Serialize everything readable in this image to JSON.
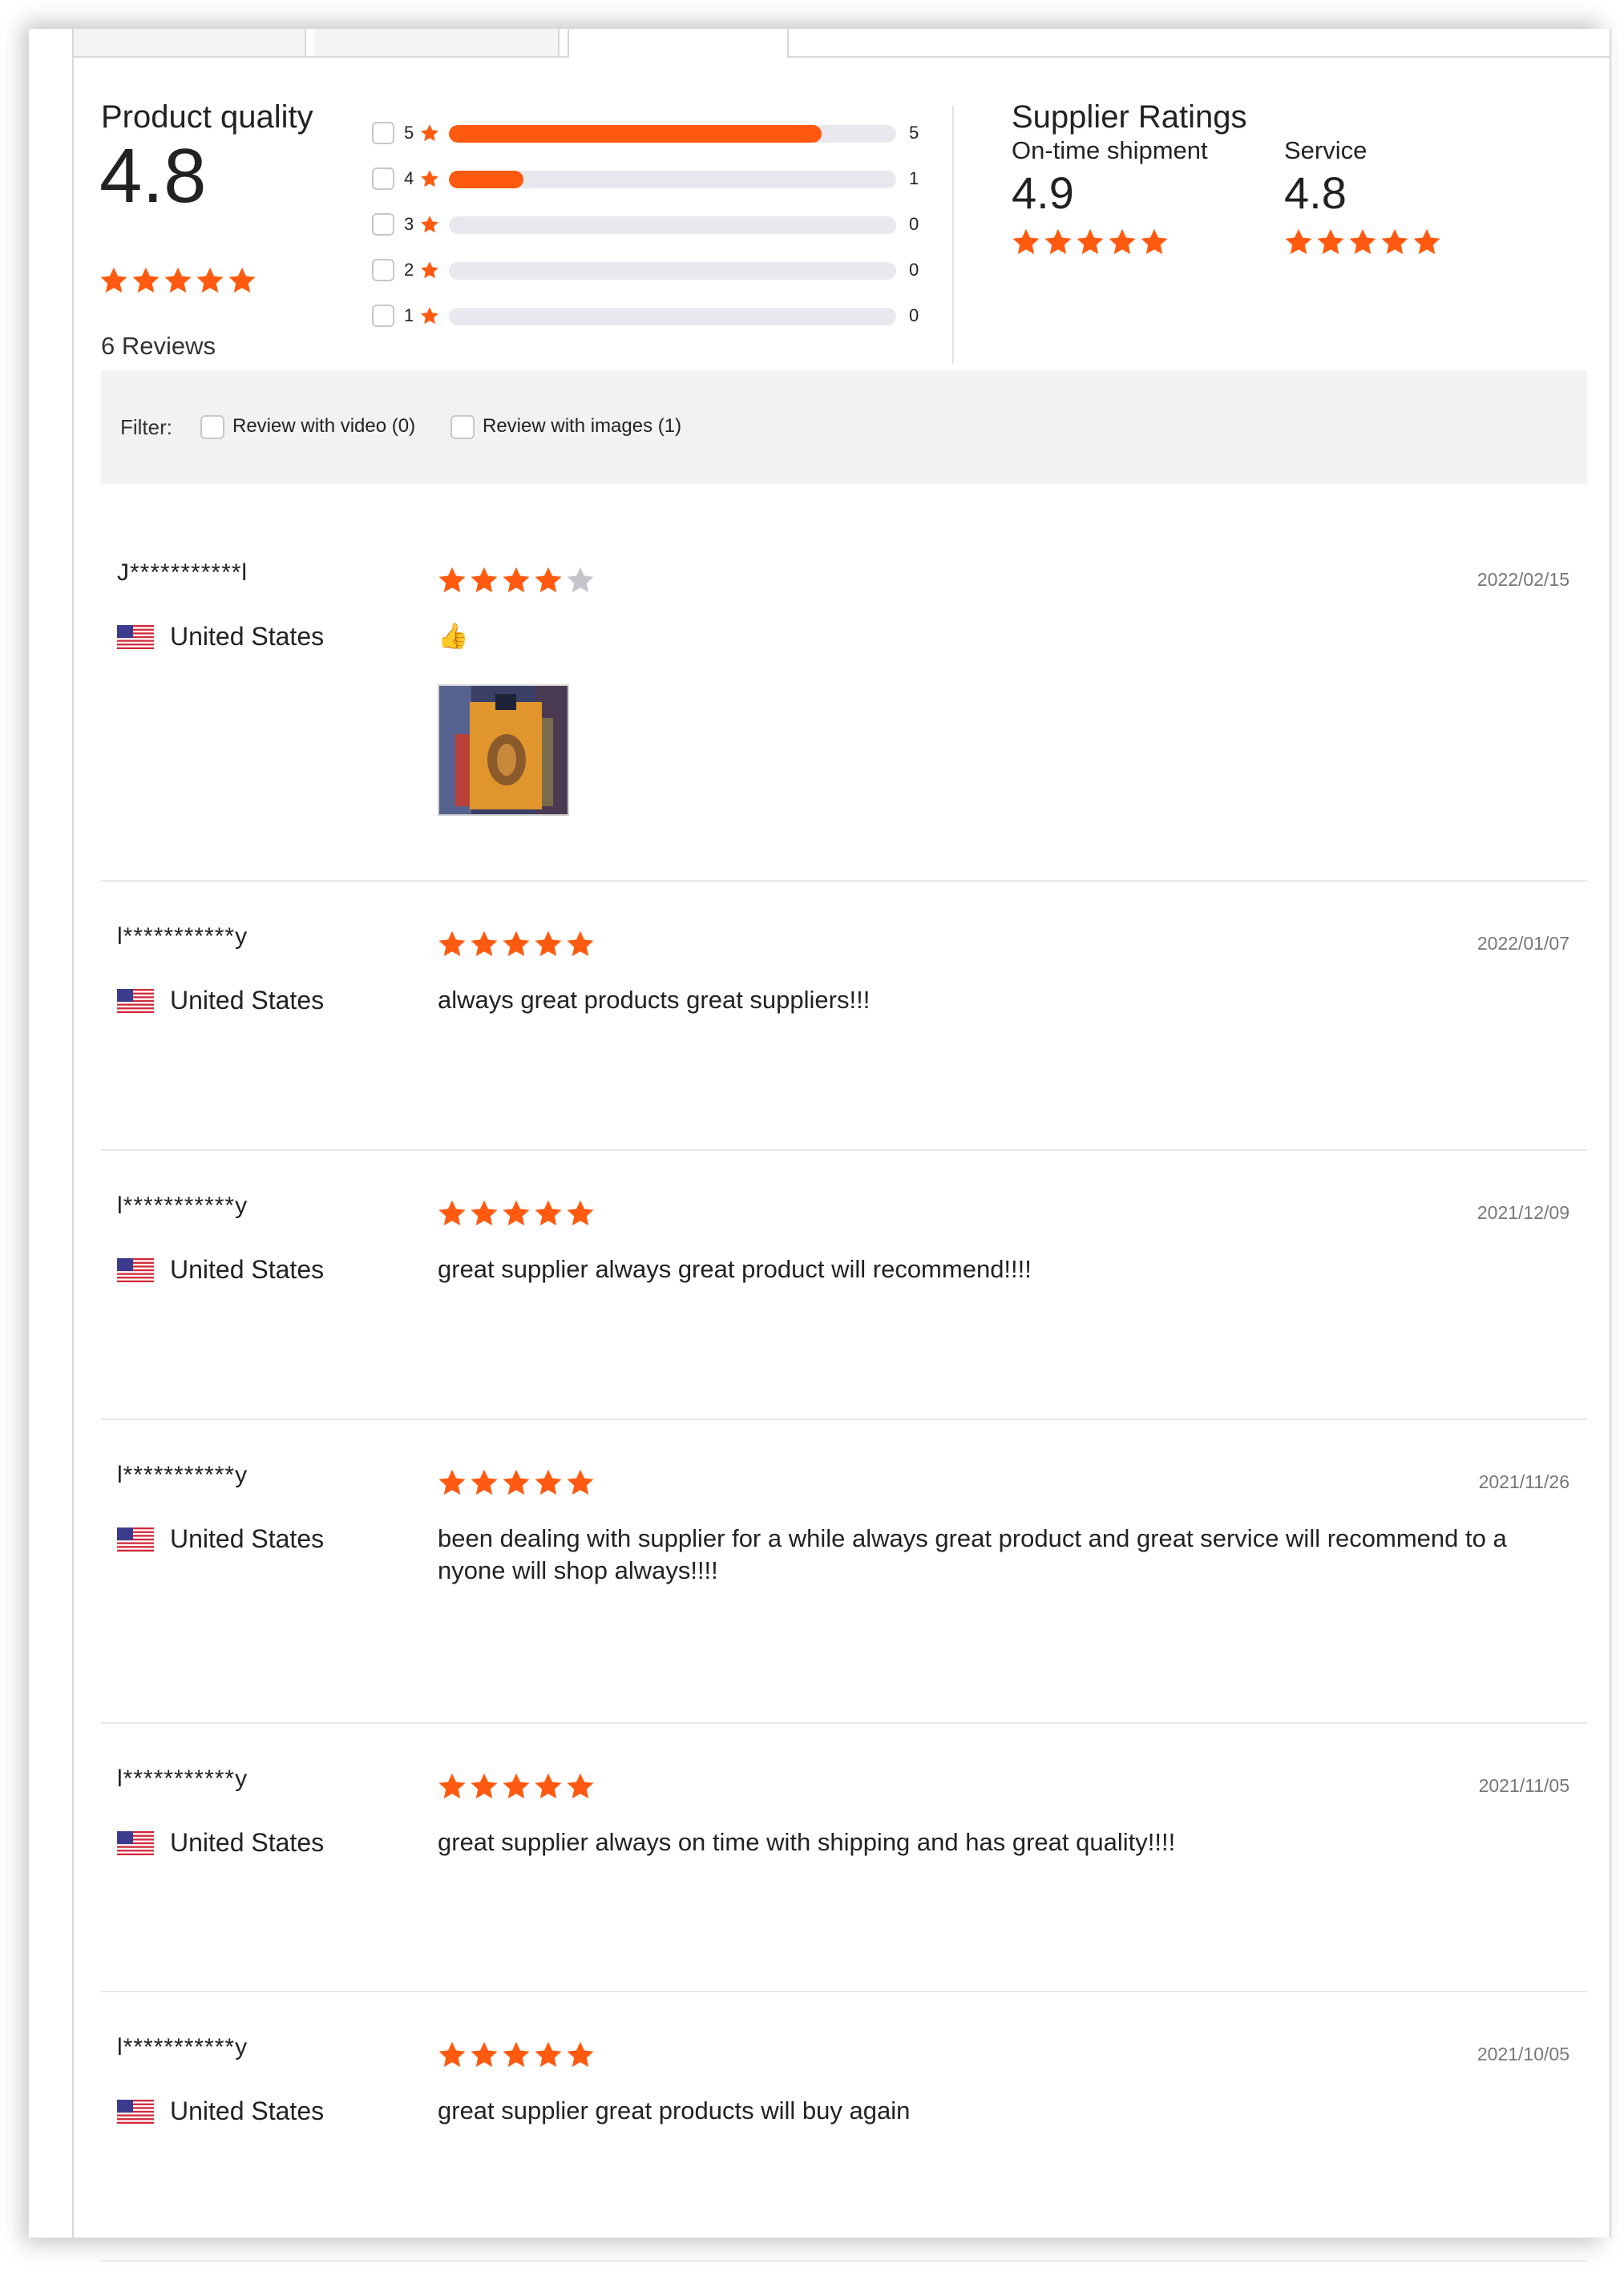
{
  "product_quality": {
    "title": "Product quality",
    "score": "4.8",
    "stars": 5,
    "reviews_label": "6 Reviews"
  },
  "histogram": [
    {
      "stars": "5",
      "count": "5",
      "fraction": 0.833
    },
    {
      "stars": "4",
      "count": "1",
      "fraction": 0.167
    },
    {
      "stars": "3",
      "count": "0",
      "fraction": 0
    },
    {
      "stars": "2",
      "count": "0",
      "fraction": 0
    },
    {
      "stars": "1",
      "count": "0",
      "fraction": 0
    }
  ],
  "supplier_ratings": {
    "title": "Supplier Ratings",
    "on_time": {
      "label": "On-time shipment",
      "score": "4.9",
      "stars": 5
    },
    "service": {
      "label": "Service",
      "score": "4.8",
      "stars": 5
    }
  },
  "filter": {
    "label": "Filter:",
    "video_label": "Review with video (0)",
    "images_label": "Review with images (1)"
  },
  "colors": {
    "accent": "#ff5a0f",
    "star_empty": "#c4c4cc",
    "filter_bg": "#f2f2f2"
  },
  "reviews": [
    {
      "user": "J***********l",
      "country": "United States",
      "rating": 4,
      "date": "2022/02/15",
      "text": "👍",
      "has_image": true
    },
    {
      "user": "l***********y",
      "country": "United States",
      "rating": 5,
      "date": "2022/01/07",
      "text": "always great products great suppliers!!!",
      "has_image": false
    },
    {
      "user": "l***********y",
      "country": "United States",
      "rating": 5,
      "date": "2021/12/09",
      "text": "great supplier always great product will recommend!!!!",
      "has_image": false
    },
    {
      "user": "l***********y",
      "country": "United States",
      "rating": 5,
      "date": "2021/11/26",
      "text": "been dealing with supplier for a while always great product and great service will recommend to a nyone will shop always!!!!",
      "has_image": false
    },
    {
      "user": "l***********y",
      "country": "United States",
      "rating": 5,
      "date": "2021/11/05",
      "text": "great supplier always on time with shipping and has great quality!!!!",
      "has_image": false
    },
    {
      "user": "l***********y",
      "country": "United States",
      "rating": 5,
      "date": "2021/10/05",
      "text": "great supplier great products will buy again",
      "has_image": false
    }
  ]
}
